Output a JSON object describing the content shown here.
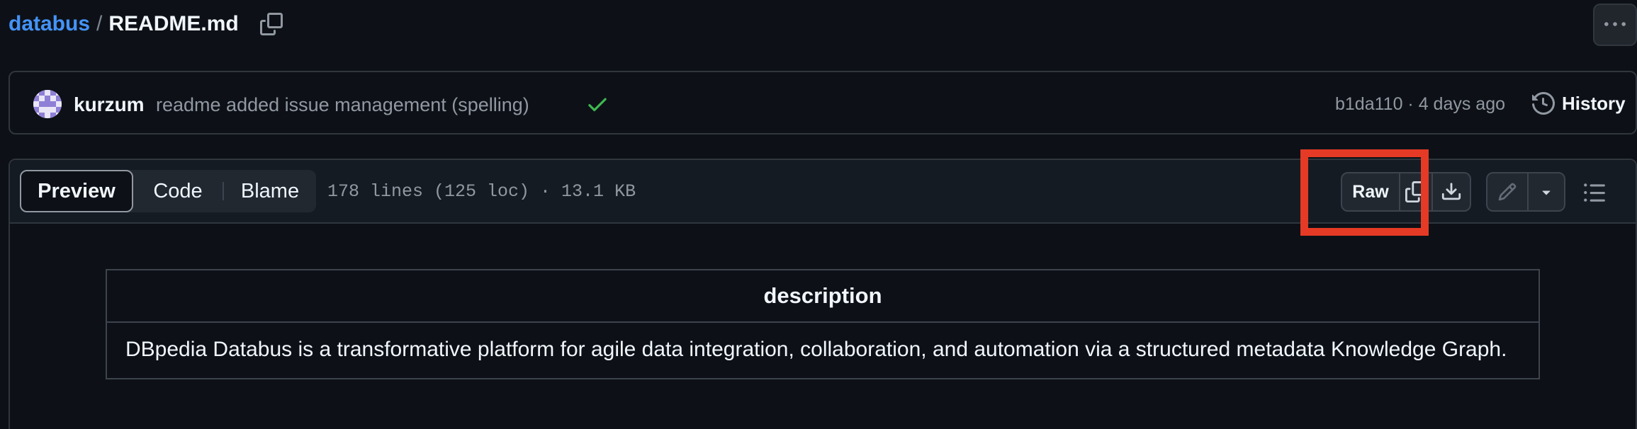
{
  "breadcrumb": {
    "repo": "databus",
    "separator": "/",
    "file": "README.md",
    "copy_icon": "copy-icon"
  },
  "more_button": {
    "icon": "kebab-horizontal-icon"
  },
  "commit": {
    "author": "kurzum",
    "message": "readme added issue management (spelling)",
    "status_icon": "check-icon",
    "status_color": "#3fb950",
    "meta": "b1da110 · 4 days ago",
    "history_label": "History"
  },
  "file_header": {
    "tabs": [
      {
        "label": "Preview",
        "active": true
      },
      {
        "label": "Code",
        "active": false
      },
      {
        "label": "Blame",
        "active": false
      }
    ],
    "info": "178 lines (125 loc) · 13.1 KB",
    "raw_label": "Raw",
    "highlight_color": "#e53a25"
  },
  "table": {
    "header": "description",
    "cell": "DBpedia Databus is a transformative platform for agile data integration, collaboration, and automation via a structured metadata Knowledge Graph."
  },
  "colors": {
    "link": "#4493f8",
    "background": "#0d1117",
    "border": "#30363d"
  }
}
